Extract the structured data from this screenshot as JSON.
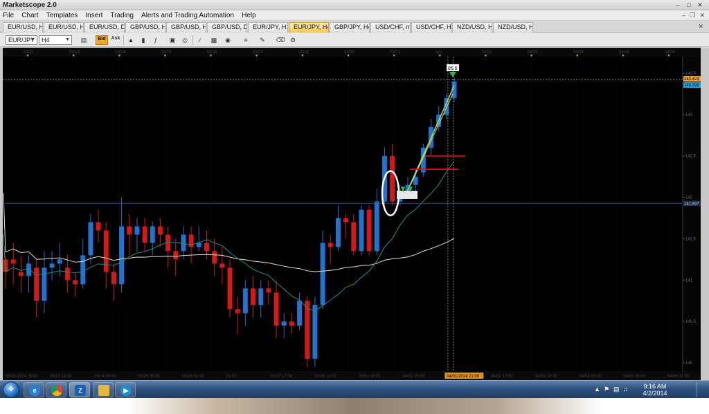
{
  "window": {
    "title": "Marketscope 2.0"
  },
  "menu": {
    "items": [
      "File",
      "Chart",
      "Templates",
      "Insert",
      "Trading",
      "Alerts and Trading Automation",
      "Help"
    ]
  },
  "tabs": [
    {
      "label": "EUR/USD, H1",
      "active": false
    },
    {
      "label": "EUR/USD, H4",
      "active": false
    },
    {
      "label": "EUR/USD, D1",
      "active": false
    },
    {
      "label": "GBP/USD, H1",
      "active": false
    },
    {
      "label": "GBP/USD, H4",
      "active": false
    },
    {
      "label": "GBP/USD, D1",
      "active": false
    },
    {
      "label": "EUR/JPY, H1",
      "active": false
    },
    {
      "label": "EUR/JPY, H4",
      "active": true
    },
    {
      "label": "GBP/JPY, H4",
      "active": false
    },
    {
      "label": "USD/CHF, m5",
      "active": false
    },
    {
      "label": "USD/CHF, H1",
      "active": false
    },
    {
      "label": "NZD/USD, H1",
      "active": false
    },
    {
      "label": "NZD/USD, H4",
      "active": false
    }
  ],
  "toolbar": {
    "instrument": "EUR/JPY",
    "timeframe": "H4",
    "bid_label": "Bid",
    "ask_label": "Ask",
    "icons": [
      "candles-icon",
      "volume-icon",
      "bar-icon",
      "indicator-icon",
      "new-chart-icon",
      "globe-icon",
      "ruler-icon",
      "image-icon",
      "eye-icon",
      "hand-icon",
      "lines-icon",
      "pen-icon",
      "eraser-icon",
      "settings-icon"
    ]
  },
  "chart_data": {
    "type": "candlestick",
    "instrument": "EUR/JPY",
    "timeframe": "H4",
    "ylim": [
      139.9,
      143.7
    ],
    "y_ticks": [
      140.0,
      140.5,
      141.0,
      141.5,
      142.0,
      142.5,
      143.0,
      143.5
    ],
    "top_date_labels": [
      "03/21",
      "03/23",
      "03/24",
      "03/25",
      "03/26",
      "03/27",
      "03/28",
      "03/30",
      "03/31",
      "Apr",
      "04/02",
      "04/03",
      "04/04",
      "04/05",
      "04/06"
    ],
    "bottom_time_labels": [
      "03/20/2014 09:00",
      "03/23 13:00",
      "03/24 09:00",
      "03/25 05:00",
      "03/26 01:00",
      "21:00",
      "03/27 17:00",
      "03/28 13:00",
      "03/31 09:00",
      "04/01 05:00",
      "04/01/2014 21:00",
      "04/02 17:00",
      "04/03 13:00",
      "04/04 09:00",
      "04/05 05:00",
      "04/06 01:00"
    ],
    "price_labels": {
      "ask": "143.424",
      "bid": "143.398",
      "crosshair": "141.927"
    },
    "marker_label": "85.6",
    "candles": [
      [
        141.25,
        141.1,
        141.3,
        140.9
      ],
      [
        141.25,
        141.2,
        141.45,
        140.95
      ],
      [
        141.1,
        141.05,
        141.3,
        140.85
      ],
      [
        141.05,
        141.2,
        141.3,
        140.85
      ],
      [
        141.15,
        140.75,
        141.25,
        140.55
      ],
      [
        140.75,
        141.15,
        141.35,
        140.6
      ],
      [
        141.15,
        141.2,
        141.35,
        141.0
      ],
      [
        141.2,
        141.25,
        141.45,
        141.05
      ],
      [
        141.15,
        141.0,
        141.3,
        140.85
      ],
      [
        141.0,
        140.95,
        141.1,
        140.8
      ],
      [
        140.95,
        141.3,
        141.5,
        140.9
      ],
      [
        141.3,
        141.7,
        141.8,
        141.2
      ],
      [
        141.7,
        141.6,
        141.85,
        141.45
      ],
      [
        141.6,
        141.1,
        141.7,
        140.9
      ],
      [
        141.1,
        140.95,
        141.2,
        140.75
      ],
      [
        140.95,
        141.65,
        142.0,
        140.85
      ],
      [
        141.65,
        141.55,
        141.8,
        141.3
      ],
      [
        141.55,
        141.65,
        141.75,
        141.35
      ],
      [
        141.65,
        141.45,
        141.75,
        141.35
      ],
      [
        141.45,
        141.65,
        141.7,
        141.3
      ],
      [
        141.65,
        141.55,
        141.75,
        141.4
      ],
      [
        141.55,
        141.35,
        141.65,
        141.15
      ],
      [
        141.35,
        141.25,
        141.5,
        141.05
      ],
      [
        141.35,
        141.55,
        141.65,
        141.25
      ],
      [
        141.55,
        141.4,
        141.65,
        141.2
      ],
      [
        141.4,
        141.45,
        141.65,
        141.35
      ],
      [
        141.45,
        141.35,
        141.6,
        141.25
      ],
      [
        141.35,
        141.2,
        141.5,
        141.05
      ],
      [
        141.2,
        141.15,
        141.4,
        140.95
      ],
      [
        141.15,
        140.65,
        141.25,
        140.55
      ],
      [
        140.65,
        140.6,
        140.8,
        140.35
      ],
      [
        140.6,
        140.9,
        141.0,
        140.45
      ],
      [
        140.9,
        140.7,
        141.05,
        140.55
      ],
      [
        140.7,
        140.9,
        141.0,
        140.55
      ],
      [
        140.9,
        140.85,
        141.0,
        140.7
      ],
      [
        140.85,
        140.45,
        141.0,
        140.3
      ],
      [
        140.45,
        140.5,
        140.6,
        140.3
      ],
      [
        140.5,
        140.45,
        140.6,
        140.35
      ],
      [
        140.45,
        140.75,
        140.85,
        140.4
      ],
      [
        140.75,
        140.05,
        140.8,
        139.95
      ],
      [
        140.05,
        140.7,
        140.8,
        139.95
      ],
      [
        140.7,
        141.45,
        141.6,
        140.65
      ],
      [
        141.45,
        141.4,
        141.55,
        141.2
      ],
      [
        141.4,
        141.75,
        141.9,
        141.35
      ],
      [
        141.75,
        141.7,
        141.8,
        141.5
      ],
      [
        141.7,
        141.35,
        141.8,
        141.3
      ],
      [
        141.35,
        141.85,
        141.9,
        141.3
      ],
      [
        141.85,
        141.35,
        141.9,
        141.3
      ],
      [
        141.35,
        141.95,
        142.1,
        141.3
      ],
      [
        141.95,
        142.5,
        142.6,
        141.85
      ],
      [
        142.5,
        141.95,
        142.65,
        141.9
      ],
      [
        141.95,
        142.05,
        142.15,
        141.9
      ],
      [
        142.05,
        142.15,
        142.25,
        142.0
      ],
      [
        142.15,
        142.25,
        142.35,
        142.05
      ],
      [
        142.3,
        142.6,
        142.65,
        142.25
      ],
      [
        142.6,
        142.85,
        142.95,
        142.5
      ],
      [
        142.85,
        143.0,
        143.1,
        142.8
      ],
      [
        143.0,
        143.2,
        143.25,
        142.95
      ],
      [
        143.2,
        143.4,
        143.45,
        143.15
      ]
    ]
  },
  "taskbar": {
    "time": "9:16 AM",
    "date": "4/2/2014",
    "apps": [
      "ie-icon",
      "chrome-icon",
      "marketscope-icon",
      "folder-icon",
      "media-icon"
    ]
  }
}
